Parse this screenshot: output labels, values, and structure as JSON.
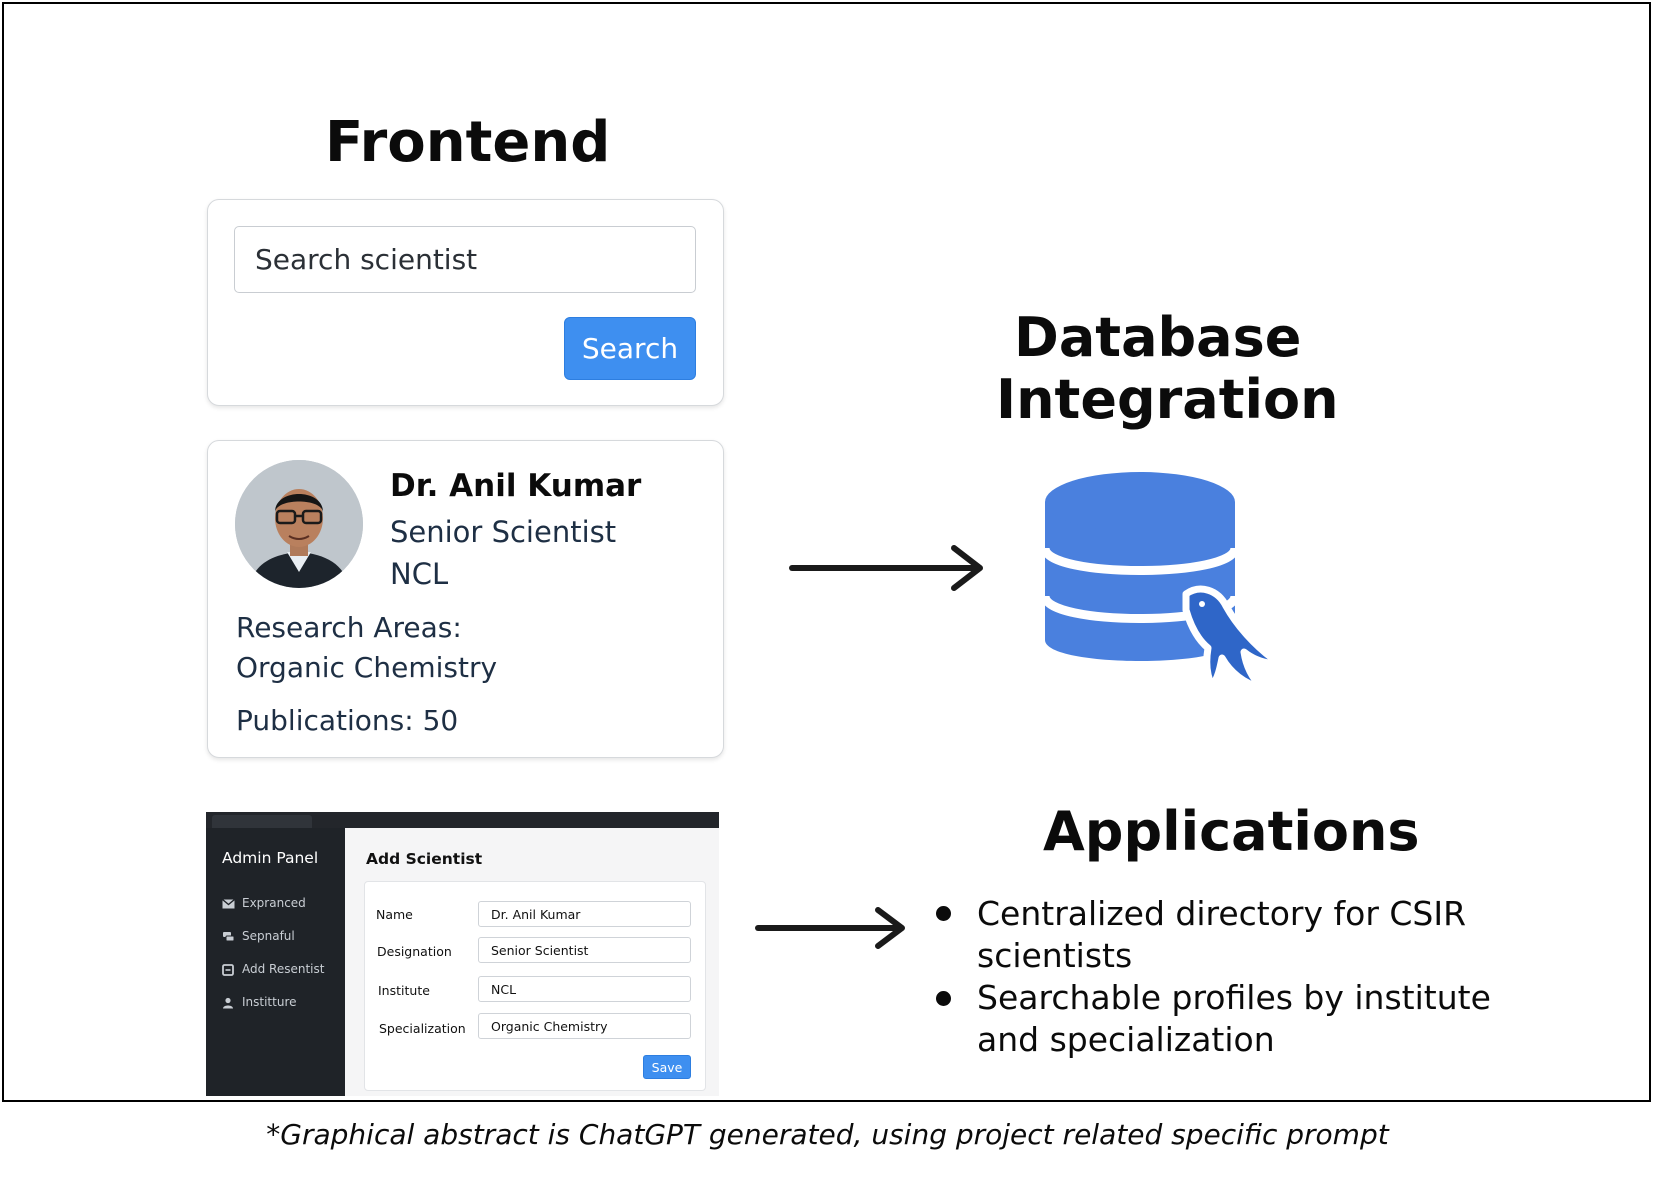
{
  "frontend": {
    "title": "Frontend",
    "search": {
      "placeholder": "Search scientist",
      "button_label": "Search"
    },
    "profile": {
      "name": "Dr. Anil Kumar",
      "designation": "Senior Scientist",
      "institute": "NCL",
      "research_label": "Research Areas:",
      "research_value": "Organic Chemistry",
      "publications": "Publications: 50"
    }
  },
  "database": {
    "title_line1": "Database",
    "title_line2": "Integration",
    "icon": "database-dolphin-icon"
  },
  "admin": {
    "panel_title": "Admin Panel",
    "menu": [
      {
        "label": "Expranced",
        "icon": "mail-icon"
      },
      {
        "label": "Sepnaful",
        "icon": "chat-icon"
      },
      {
        "label": "Add Resentist",
        "icon": "add-box-icon"
      },
      {
        "label": "Institture",
        "icon": "user-icon"
      }
    ],
    "form_title": "Add Scientist",
    "fields": [
      {
        "label": "Name",
        "value": "Dr. Anil Kumar"
      },
      {
        "label": "Designation",
        "value": "Senior Scientist"
      },
      {
        "label": "Institute",
        "value": "NCL"
      },
      {
        "label": "Specialization",
        "value": "Organic Chemistry"
      }
    ],
    "save_label": "Save"
  },
  "applications": {
    "title": "Applications",
    "bullets": [
      {
        "line1": "Centralized directory for CSIR",
        "line2": "scientists"
      },
      {
        "line1": "Searchable profiles by institute",
        "line2": "and specialization"
      }
    ]
  },
  "caption": "*Graphical abstract is ChatGPT generated, using project related specific prompt",
  "colors": {
    "accent_blue": "#3e8ff0",
    "db_blue": "#4a80de",
    "dark_panel": "#1f2328",
    "navy_text": "#1e2f44"
  }
}
